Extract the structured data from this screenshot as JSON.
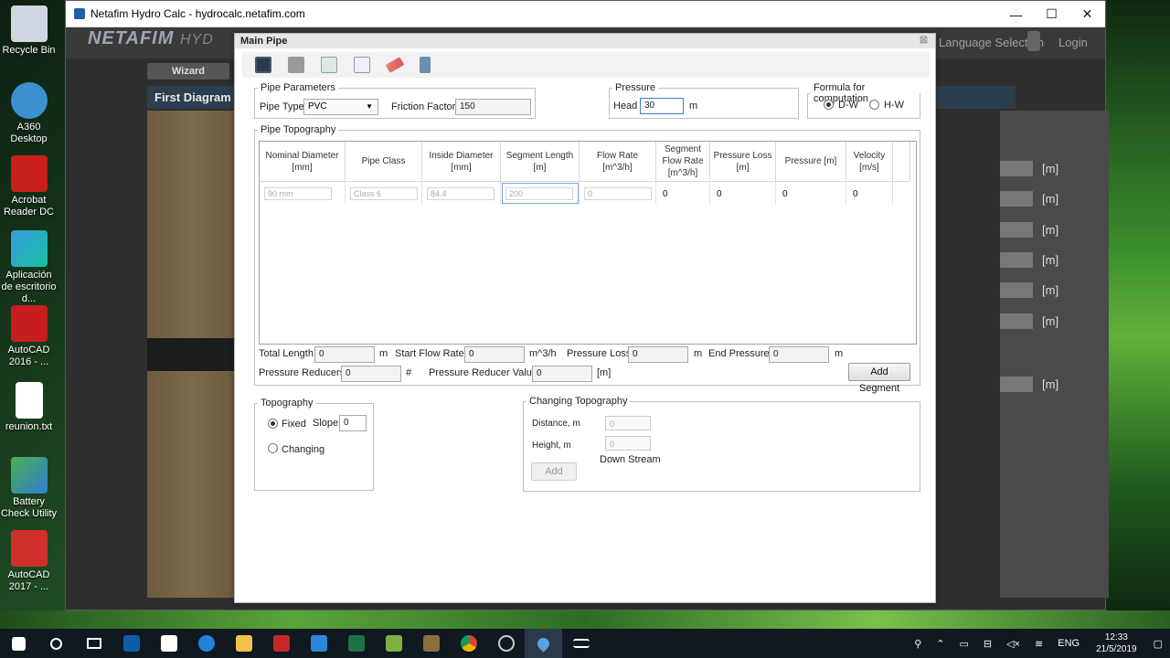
{
  "desktop": {
    "icons": [
      {
        "label": "Recycle Bin"
      },
      {
        "label": "A360 Desktop"
      },
      {
        "label": "Acrobat Reader DC"
      },
      {
        "label": "Aplicación de escritorio d..."
      },
      {
        "label": "AutoCAD 2016 - ..."
      },
      {
        "label": "reunion.txt"
      },
      {
        "label": "Battery Check Utility"
      },
      {
        "label": "AutoCAD 2017 - ..."
      }
    ]
  },
  "browser": {
    "title": "Netafim Hydro Calc - hydrocalc.netafim.com",
    "controls": {
      "minimize": "—",
      "maximize": "☐",
      "close": "✕"
    }
  },
  "site": {
    "logo": "NETAFIM",
    "logo_suffix": "HYD",
    "language": "Language Selection",
    "login": "Login",
    "wizard_tab": "Wizard",
    "section_title": "First Diagram",
    "unit": "[m]"
  },
  "dialog": {
    "title": "Main Pipe",
    "close": "☒",
    "pipe_parameters": {
      "legend": "Pipe Parameters",
      "pipe_type_label": "Pipe Type",
      "pipe_type_value": "PVC",
      "friction_factor_label": "Friction Factor",
      "friction_factor_value": "150"
    },
    "pressure": {
      "legend": "Pressure",
      "head_label": "Head",
      "head_value": "30",
      "unit": "m"
    },
    "formula": {
      "legend": "Formula for computation",
      "option_dw": "D-W",
      "option_hw": "H-W",
      "selected": "D-W"
    },
    "pipe_topography": {
      "legend": "Pipe Topography",
      "columns": [
        {
          "line1": "Nominal Diameter",
          "line2": "[mm]"
        },
        {
          "line1": "Pipe Class",
          "line2": ""
        },
        {
          "line1": "Inside Diameter",
          "line2": "[mm]"
        },
        {
          "line1": "Segment Length",
          "line2": "[m]"
        },
        {
          "line1": "Flow Rate",
          "line2": "[m^3/h]"
        },
        {
          "line1": "Segment Flow Rate",
          "line2": "[m^3/h]"
        },
        {
          "line1": "Pressure Loss",
          "line2": "[m]"
        },
        {
          "line1": "Pressure [m]",
          "line2": ""
        },
        {
          "line1": "Velocity",
          "line2": "[m/s]"
        }
      ],
      "row": {
        "nominal_diameter": "90 mm",
        "pipe_class": "Class 6",
        "inside_diameter": "84.4",
        "segment_length": "200",
        "flow_rate": "0",
        "segment_flow_rate": "0",
        "pressure_loss": "0",
        "pressure": "0",
        "velocity": "0"
      },
      "total_length_label": "Total Length",
      "total_length_value": "0",
      "total_length_unit": "m",
      "start_flow_label": "Start Flow Rate",
      "start_flow_value": "0",
      "start_flow_unit": "m^3/h",
      "pressure_loss_label": "Pressure Loss",
      "pressure_loss_value": "0",
      "pressure_loss_unit": "m",
      "end_pressure_label": "End Pressure",
      "end_pressure_value": "0",
      "end_pressure_unit": "m",
      "reducers_label": "Pressure Reducers",
      "reducers_value": "0",
      "reducers_unit": "#",
      "reducer_value_label": "Pressure Reducer Value",
      "reducer_value_value": "0",
      "reducer_value_unit": "[m]",
      "add_segment": "Add Segment"
    },
    "topography": {
      "legend": "Topography",
      "fixed_label": "Fixed",
      "slope_label": "Slope",
      "slope_value": "0",
      "changing_label": "Changing",
      "selected": "Fixed"
    },
    "changing_topography": {
      "legend": "Changing Topography",
      "distance_label": "Distance, m",
      "distance_value": "0",
      "height_label": "Height, m",
      "height_value": "0",
      "direction": "Down Stream",
      "add_button": "Add"
    }
  },
  "taskbar": {
    "language": "ENG",
    "time": "12:33",
    "date": "21/5/2019"
  }
}
